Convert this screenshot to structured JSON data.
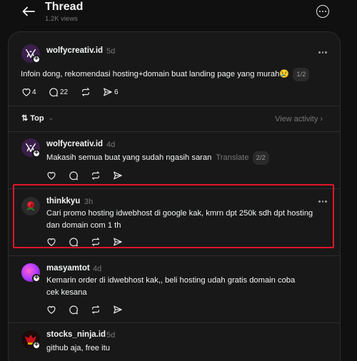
{
  "header": {
    "title": "Thread",
    "views": "1.2K views"
  },
  "main_post": {
    "username": "wolfycreativ.id",
    "time": "5d",
    "text": "Infoin dong, rekomendasi hosting+domain buat landing page yang murah😢",
    "page_badge": "1/2",
    "likes": "4",
    "comments": "22",
    "shares": "6"
  },
  "sort": {
    "label": "Top",
    "view_activity": "View activity"
  },
  "replies": [
    {
      "username": "wolfycreativ.id",
      "time": "4d",
      "text": "Makasih semua buat yang sudah ngasih saran",
      "translate": "Translate",
      "page_badge": "2/2"
    },
    {
      "username": "thinkkyu",
      "time": "3h",
      "text_line1": "Cari promo hosting idwebhost di google kak, kmrn dpt 250k sdh dpt hosting",
      "text_line2": "dan domain com 1 th"
    },
    {
      "username": "masyamtot",
      "time": "4d",
      "text_line1": "Kemarin order di idwebhost kak,, beli hosting udah gratis domain coba",
      "text_line2": "cek kesana"
    },
    {
      "username": "stocks_ninja.id",
      "time": "5d",
      "text": "github aja, free itu"
    }
  ],
  "colors": {
    "background": "#101010",
    "card": "#181818",
    "highlight": "#e0152b",
    "muted": "#777777"
  }
}
